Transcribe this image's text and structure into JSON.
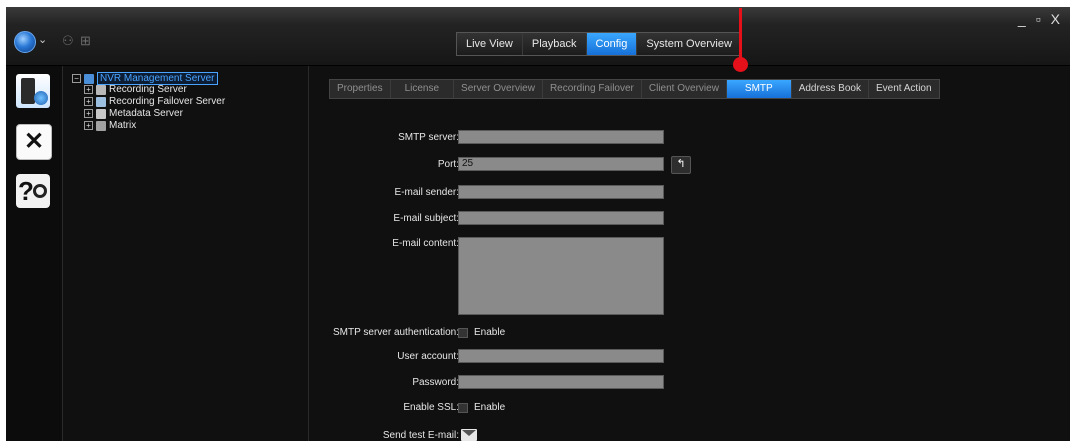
{
  "window": {
    "minimize": "_",
    "restore": "▫",
    "close": "X"
  },
  "toolbar": {
    "logo_icon": "globe-menu-icon",
    "chevron": "⌄",
    "icon1": "⚇",
    "icon2": "⊞"
  },
  "main_tabs": [
    "Live View",
    "Playback",
    "Config",
    "System Overview"
  ],
  "active_main_tab": "Config",
  "sidebar": [
    "server-config-icon",
    "tools-icon",
    "help-icon"
  ],
  "tree": {
    "root": "NVR Management Server",
    "children": [
      "Recording Server",
      "Recording Failover Server",
      "Metadata Server",
      "Matrix"
    ]
  },
  "sub_tabs": [
    "Properties",
    "License",
    "Server Overview",
    "Recording Failover",
    "Client Overview",
    "SMTP",
    "Address Book",
    "Event Action"
  ],
  "active_sub_tab": "SMTP",
  "form": {
    "smtp_server_label": "SMTP server:",
    "smtp_server_value": "",
    "port_label": "Port:",
    "port_value": "25",
    "sender_label": "E-mail sender:",
    "sender_value": "",
    "subject_label": "E-mail subject:",
    "subject_value": "",
    "content_label": "E-mail content:",
    "content_value": "",
    "auth_label": "SMTP server authentication:",
    "auth_enable": "Enable",
    "auth_checked": false,
    "account_label": "User account:",
    "account_value": "",
    "password_label": "Password:",
    "password_value": "",
    "ssl_label": "Enable SSL:",
    "ssl_enable": "Enable",
    "ssl_checked": false,
    "test_label": "Send test E-mail:"
  },
  "colors": {
    "accent": "#1f86ee",
    "annotation": "#e5101a",
    "background": "#101010",
    "input": "#8a8a8a"
  }
}
